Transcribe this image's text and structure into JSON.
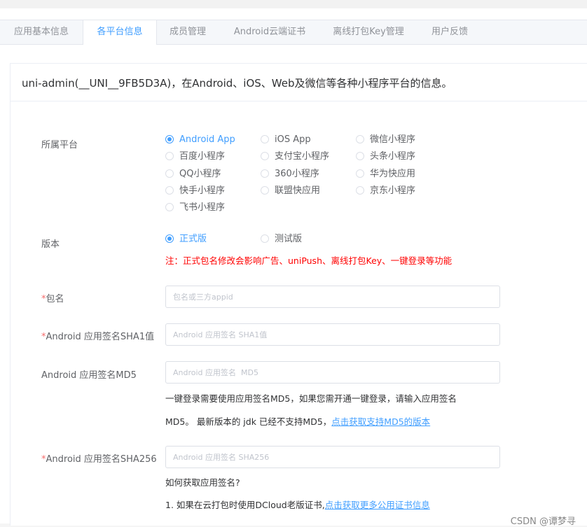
{
  "tabs": [
    {
      "label": "应用基本信息",
      "active": false
    },
    {
      "label": "各平台信息",
      "active": true
    },
    {
      "label": "成员管理",
      "active": false
    },
    {
      "label": "Android云端证书",
      "active": false
    },
    {
      "label": "离线打包Key管理",
      "active": false
    },
    {
      "label": "用户反馈",
      "active": false
    }
  ],
  "panel": {
    "title": "uni-admin(__UNI__9FB5D3A)，在Android、iOS、Web及微信等各种小程序平台的信息。"
  },
  "platform": {
    "label": "所属平台",
    "selected": "Android App",
    "options": [
      "Android App",
      "iOS App",
      "微信小程序",
      "百度小程序",
      "支付宝小程序",
      "头条小程序",
      "QQ小程序",
      "360小程序",
      "华为快应用",
      "快手小程序",
      "联盟快应用",
      "京东小程序",
      "飞书小程序"
    ]
  },
  "version": {
    "label": "版本",
    "selected": "正式版",
    "options": [
      "正式版",
      "测试版"
    ],
    "warning": "注：正式包名修改会影响广告、uniPush、离线打包Key、一键登录等功能"
  },
  "package": {
    "required_mark": "*",
    "label": "包名",
    "placeholder": "包名或三方appid"
  },
  "sha1": {
    "required_mark": "*",
    "label": "Android 应用签名SHA1值",
    "placeholder": "Android 应用签名 SHA1值"
  },
  "md5": {
    "label": "Android 应用签名MD5",
    "placeholder": "Android 应用签名  MD5",
    "note_line1": "一键登录需要使用应用签名MD5，如果您需开通一键登录，请输入应用签名",
    "note_line2": "MD5。 最新版本的 jdk 已经不支持MD5，",
    "link": "点击获取支持MD5的版本"
  },
  "sha256": {
    "required_mark": "*",
    "label": "Android 应用签名SHA256",
    "placeholder": "Android 应用签名 SHA256",
    "help_title": "如何获取应用签名?",
    "help_line1": "1. 如果在云打包时使用DCloud老版证书,",
    "help_link": "点击获取更多公用证书信息"
  },
  "watermark": "CSDN @谭梦寻"
}
